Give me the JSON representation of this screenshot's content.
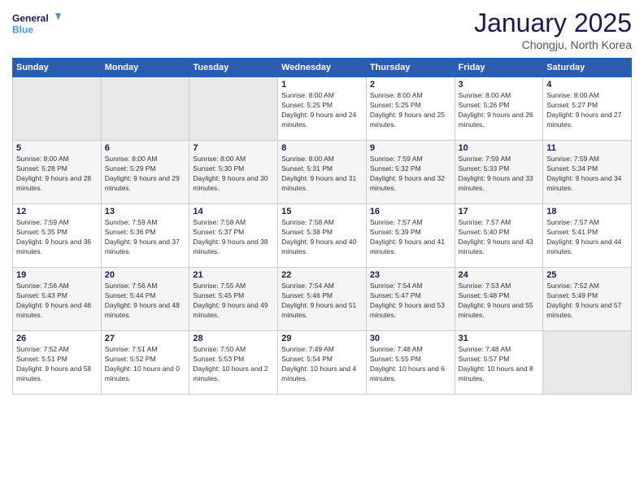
{
  "logo": {
    "line1": "General",
    "line2": "Blue"
  },
  "title": "January 2025",
  "location": "Chongju, North Korea",
  "weekdays": [
    "Sunday",
    "Monday",
    "Tuesday",
    "Wednesday",
    "Thursday",
    "Friday",
    "Saturday"
  ],
  "weeks": [
    [
      {
        "day": "",
        "sunrise": "",
        "sunset": "",
        "daylight": ""
      },
      {
        "day": "",
        "sunrise": "",
        "sunset": "",
        "daylight": ""
      },
      {
        "day": "",
        "sunrise": "",
        "sunset": "",
        "daylight": ""
      },
      {
        "day": "1",
        "sunrise": "Sunrise: 8:00 AM",
        "sunset": "Sunset: 5:25 PM",
        "daylight": "Daylight: 9 hours and 24 minutes."
      },
      {
        "day": "2",
        "sunrise": "Sunrise: 8:00 AM",
        "sunset": "Sunset: 5:25 PM",
        "daylight": "Daylight: 9 hours and 25 minutes."
      },
      {
        "day": "3",
        "sunrise": "Sunrise: 8:00 AM",
        "sunset": "Sunset: 5:26 PM",
        "daylight": "Daylight: 9 hours and 26 minutes."
      },
      {
        "day": "4",
        "sunrise": "Sunrise: 8:00 AM",
        "sunset": "Sunset: 5:27 PM",
        "daylight": "Daylight: 9 hours and 27 minutes."
      }
    ],
    [
      {
        "day": "5",
        "sunrise": "Sunrise: 8:00 AM",
        "sunset": "Sunset: 5:28 PM",
        "daylight": "Daylight: 9 hours and 28 minutes."
      },
      {
        "day": "6",
        "sunrise": "Sunrise: 8:00 AM",
        "sunset": "Sunset: 5:29 PM",
        "daylight": "Daylight: 9 hours and 29 minutes."
      },
      {
        "day": "7",
        "sunrise": "Sunrise: 8:00 AM",
        "sunset": "Sunset: 5:30 PM",
        "daylight": "Daylight: 9 hours and 30 minutes."
      },
      {
        "day": "8",
        "sunrise": "Sunrise: 8:00 AM",
        "sunset": "Sunset: 5:31 PM",
        "daylight": "Daylight: 9 hours and 31 minutes."
      },
      {
        "day": "9",
        "sunrise": "Sunrise: 7:59 AM",
        "sunset": "Sunset: 5:32 PM",
        "daylight": "Daylight: 9 hours and 32 minutes."
      },
      {
        "day": "10",
        "sunrise": "Sunrise: 7:59 AM",
        "sunset": "Sunset: 5:33 PM",
        "daylight": "Daylight: 9 hours and 33 minutes."
      },
      {
        "day": "11",
        "sunrise": "Sunrise: 7:59 AM",
        "sunset": "Sunset: 5:34 PM",
        "daylight": "Daylight: 9 hours and 34 minutes."
      }
    ],
    [
      {
        "day": "12",
        "sunrise": "Sunrise: 7:59 AM",
        "sunset": "Sunset: 5:35 PM",
        "daylight": "Daylight: 9 hours and 36 minutes."
      },
      {
        "day": "13",
        "sunrise": "Sunrise: 7:59 AM",
        "sunset": "Sunset: 5:36 PM",
        "daylight": "Daylight: 9 hours and 37 minutes."
      },
      {
        "day": "14",
        "sunrise": "Sunrise: 7:58 AM",
        "sunset": "Sunset: 5:37 PM",
        "daylight": "Daylight: 9 hours and 38 minutes."
      },
      {
        "day": "15",
        "sunrise": "Sunrise: 7:58 AM",
        "sunset": "Sunset: 5:38 PM",
        "daylight": "Daylight: 9 hours and 40 minutes."
      },
      {
        "day": "16",
        "sunrise": "Sunrise: 7:57 AM",
        "sunset": "Sunset: 5:39 PM",
        "daylight": "Daylight: 9 hours and 41 minutes."
      },
      {
        "day": "17",
        "sunrise": "Sunrise: 7:57 AM",
        "sunset": "Sunset: 5:40 PM",
        "daylight": "Daylight: 9 hours and 43 minutes."
      },
      {
        "day": "18",
        "sunrise": "Sunrise: 7:57 AM",
        "sunset": "Sunset: 5:41 PM",
        "daylight": "Daylight: 9 hours and 44 minutes."
      }
    ],
    [
      {
        "day": "19",
        "sunrise": "Sunrise: 7:56 AM",
        "sunset": "Sunset: 5:43 PM",
        "daylight": "Daylight: 9 hours and 46 minutes."
      },
      {
        "day": "20",
        "sunrise": "Sunrise: 7:56 AM",
        "sunset": "Sunset: 5:44 PM",
        "daylight": "Daylight: 9 hours and 48 minutes."
      },
      {
        "day": "21",
        "sunrise": "Sunrise: 7:55 AM",
        "sunset": "Sunset: 5:45 PM",
        "daylight": "Daylight: 9 hours and 49 minutes."
      },
      {
        "day": "22",
        "sunrise": "Sunrise: 7:54 AM",
        "sunset": "Sunset: 5:46 PM",
        "daylight": "Daylight: 9 hours and 51 minutes."
      },
      {
        "day": "23",
        "sunrise": "Sunrise: 7:54 AM",
        "sunset": "Sunset: 5:47 PM",
        "daylight": "Daylight: 9 hours and 53 minutes."
      },
      {
        "day": "24",
        "sunrise": "Sunrise: 7:53 AM",
        "sunset": "Sunset: 5:48 PM",
        "daylight": "Daylight: 9 hours and 55 minutes."
      },
      {
        "day": "25",
        "sunrise": "Sunrise: 7:52 AM",
        "sunset": "Sunset: 5:49 PM",
        "daylight": "Daylight: 9 hours and 57 minutes."
      }
    ],
    [
      {
        "day": "26",
        "sunrise": "Sunrise: 7:52 AM",
        "sunset": "Sunset: 5:51 PM",
        "daylight": "Daylight: 9 hours and 58 minutes."
      },
      {
        "day": "27",
        "sunrise": "Sunrise: 7:51 AM",
        "sunset": "Sunset: 5:52 PM",
        "daylight": "Daylight: 10 hours and 0 minutes."
      },
      {
        "day": "28",
        "sunrise": "Sunrise: 7:50 AM",
        "sunset": "Sunset: 5:53 PM",
        "daylight": "Daylight: 10 hours and 2 minutes."
      },
      {
        "day": "29",
        "sunrise": "Sunrise: 7:49 AM",
        "sunset": "Sunset: 5:54 PM",
        "daylight": "Daylight: 10 hours and 4 minutes."
      },
      {
        "day": "30",
        "sunrise": "Sunrise: 7:48 AM",
        "sunset": "Sunset: 5:55 PM",
        "daylight": "Daylight: 10 hours and 6 minutes."
      },
      {
        "day": "31",
        "sunrise": "Sunrise: 7:48 AM",
        "sunset": "Sunset: 5:57 PM",
        "daylight": "Daylight: 10 hours and 8 minutes."
      },
      {
        "day": "",
        "sunrise": "",
        "sunset": "",
        "daylight": ""
      }
    ]
  ]
}
